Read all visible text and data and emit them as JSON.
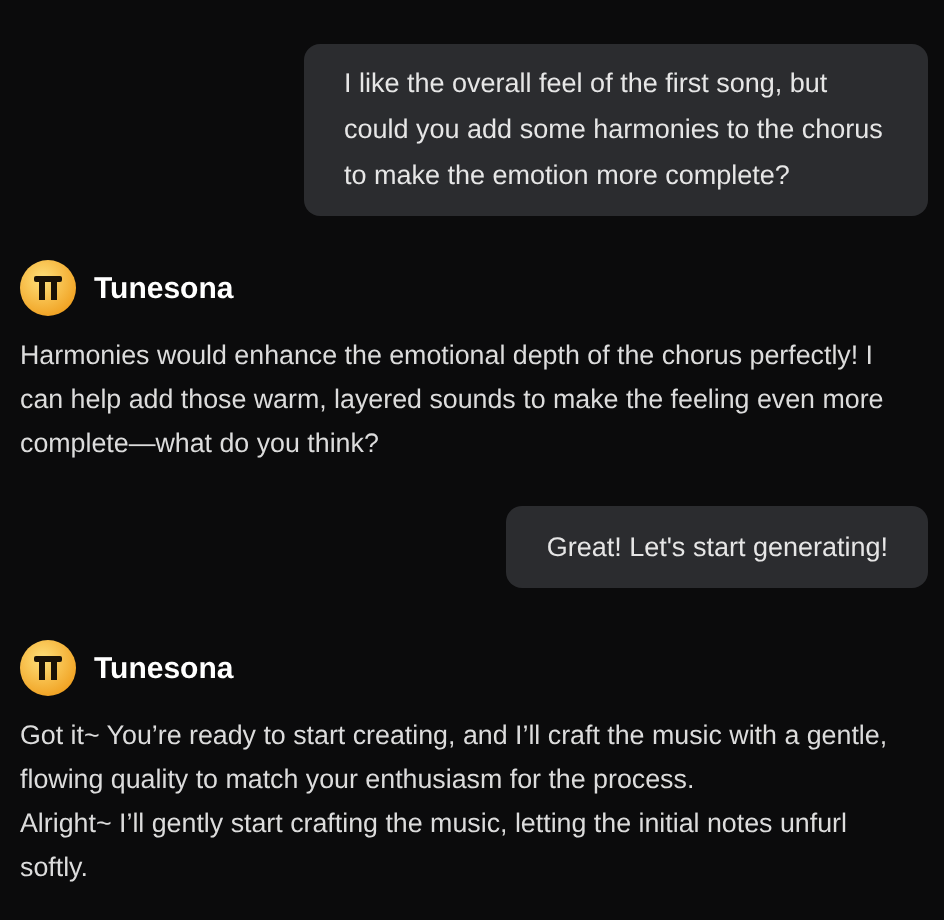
{
  "messages": [
    {
      "kind": "user",
      "text": "I like the overall feel of the first song, but could you add some harmonies to the chorus to make the emotion more complete?"
    },
    {
      "kind": "bot",
      "name": "Tunesona",
      "paragraphs": [
        "Harmonies would enhance the emotional depth of the chorus perfectly! I can help add those warm, layered sounds to make the feeling even more complete—what do you think?"
      ]
    },
    {
      "kind": "user",
      "text": "Great! Let's start generating!"
    },
    {
      "kind": "bot",
      "name": "Tunesona",
      "paragraphs": [
        "Got it~ You’re ready to start creating, and I’ll craft the music with a gentle, flowing quality to match your enthusiasm for the process.",
        "Alright~ I’ll gently start crafting the music, letting the initial notes unfurl softly."
      ]
    }
  ]
}
